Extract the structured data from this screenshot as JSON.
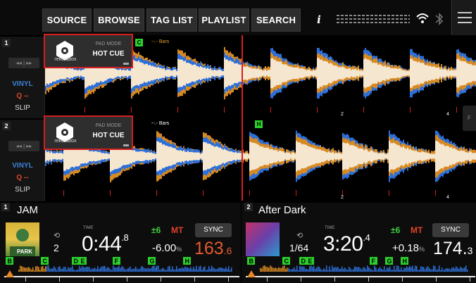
{
  "topbar": {
    "buttons": [
      "SOURCE",
      "BROWSE",
      "TAG LIST",
      "PLAYLIST",
      "SEARCH"
    ],
    "info": "i"
  },
  "deck1": {
    "number": "1",
    "transport": "◂◂ | ▸▸",
    "vinyl": "VINYL",
    "q": "Q --",
    "slip": "SLIP",
    "pad": {
      "brand": "rekordbox",
      "label": "PAD MODE",
      "mode": "HOT CUE"
    },
    "cue_marker": "C",
    "bars": "--.- Bars",
    "beat_numbers": [
      "2",
      "4"
    ]
  },
  "deck2": {
    "number": "2",
    "transport": "◂◂ | ▸▸",
    "vinyl": "VINYL",
    "q": "Q --",
    "slip": "SLIP",
    "pad": {
      "brand": "rekordbox",
      "label": "PAD MODE",
      "mode": "HOT CUE"
    },
    "cue_marker": "H",
    "bars": "--.- Bars",
    "beat_numbers": [
      "2",
      "4"
    ]
  },
  "info1": {
    "number": "1",
    "title": "JAM",
    "art_text": "PARK",
    "loop_icon": "⟲",
    "loop_value": "2",
    "time_label": "TIME",
    "time_main": "0:44",
    "time_dec": ".8",
    "range": "±6",
    "mt": "MT",
    "pitch": "-6.00",
    "pitch_unit": "%",
    "sync": "SYNC",
    "bpm_main": "163",
    "bpm_dec": ".6",
    "cues": [
      "B",
      "C",
      "D",
      "E",
      "F",
      "G",
      "H"
    ]
  },
  "info2": {
    "number": "2",
    "title": "After Dark",
    "loop_icon": "⟲",
    "loop_value": "1/64",
    "time_label": "TIME",
    "time_main": "3:20",
    "time_dec": ".4",
    "range": "±6",
    "mt": "MT",
    "pitch": "+0.18",
    "pitch_unit": "%",
    "sync": "SYNC",
    "bpm_main": "174.",
    "bpm_dec": "3",
    "cues": [
      "B",
      "C",
      "D",
      "E",
      "F",
      "G",
      "H"
    ]
  },
  "side_tab": "F",
  "colors": {
    "accent_red": "#d41f1f",
    "cue_green": "#2bd12b",
    "bpm_orange": "#e55a2e",
    "wave_cream": "#f5e6d0",
    "wave_blue": "#2d6fd8",
    "wave_orange": "#d88a22"
  }
}
